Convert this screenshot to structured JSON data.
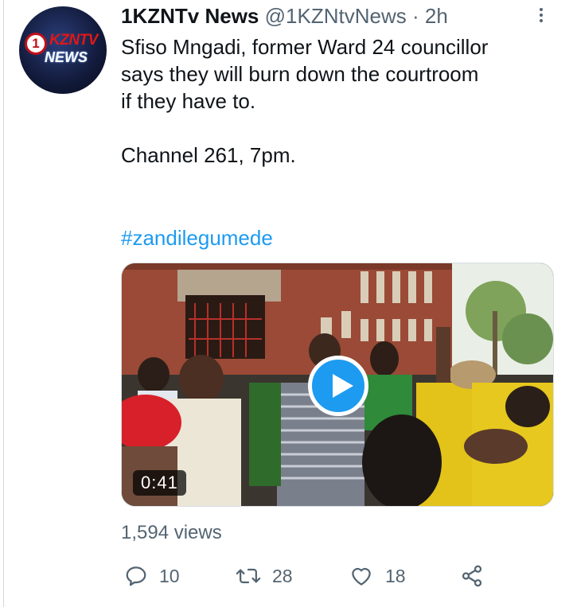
{
  "tweet": {
    "display_name": "1KZNTv News",
    "handle": "@1KZNtvNews",
    "separator": "·",
    "time": "2h",
    "avatar": {
      "badge_text": "1",
      "brand_text": "KZNTV",
      "news_text": "NEWS",
      "colors": {
        "background": "#121a3a",
        "red": "#e01818",
        "white": "#ffffff"
      }
    },
    "text": "Sfiso Mngadi, former Ward 24 councillor\nsays they will burn down the courtroom\nif they have to.\n\nChannel 261, 7pm.",
    "hashtag": "#zandilegumede",
    "video": {
      "duration": "0:41",
      "play_icon": "play-icon"
    },
    "views": "1,594 views",
    "actions": {
      "reply": {
        "icon": "reply-icon",
        "count": "10"
      },
      "retweet": {
        "icon": "retweet-icon",
        "count": "28"
      },
      "like": {
        "icon": "heart-icon",
        "count": "18"
      },
      "share": {
        "icon": "share-icon"
      }
    }
  },
  "colors": {
    "accent": "#1d9bf0",
    "text_primary": "#0f1419",
    "text_secondary": "#536471",
    "border": "#cfd9de"
  }
}
